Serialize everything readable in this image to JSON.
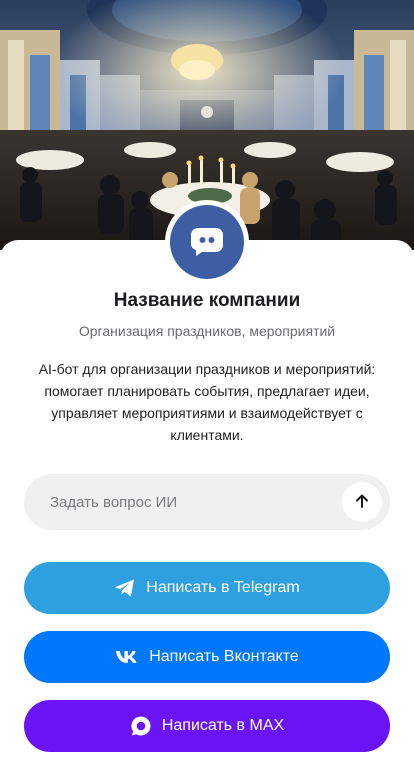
{
  "profile": {
    "company_name": "Название компании",
    "category": "Организация праздников, мероприятий",
    "description": "AI-бот для организации праздников и мероприятий: помогает планировать события, предлагает идеи, управляет мероприятиями и взаимодействует с клиентами.",
    "cover_image": "banquet-hall-photo",
    "avatar_icon": "chat-bot-icon"
  },
  "ask_ai": {
    "placeholder": "Задать вопрос ИИ",
    "value": "",
    "send_icon": "arrow-up-icon"
  },
  "actions": [
    {
      "label": "Написать в Telegram",
      "icon": "telegram-icon",
      "color": "#2ea0e0"
    },
    {
      "label": "Написать Вконтакте",
      "icon": "vk-icon",
      "color": "#0077ff"
    },
    {
      "label": "Написать в MAX",
      "icon": "max-icon",
      "color": "#6a13f4"
    }
  ],
  "colors": {
    "avatar_bg": "#3e5ea3",
    "ask_bg": "#f0f0f1"
  }
}
